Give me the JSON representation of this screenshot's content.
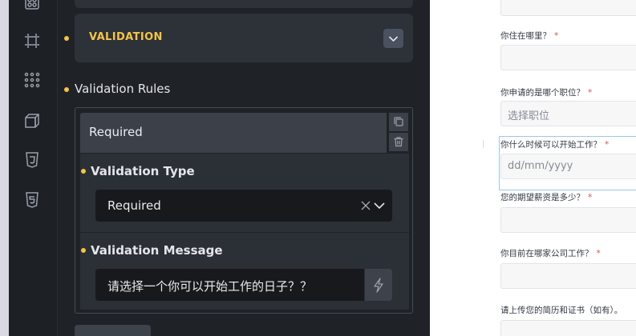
{
  "sidebar_icons": [
    "grid-icon",
    "frame-icon",
    "dots-grid-icon",
    "cube-icon",
    "css3-icon",
    "html5-icon"
  ],
  "panel": {
    "section_title": "VALIDATION",
    "rules_label": "Validation Rules",
    "rule": {
      "title": "Required",
      "validation_type_label": "Validation Type",
      "validation_type_value": "Required",
      "validation_message_label": "Validation Message",
      "validation_message_value": "请选择一个你可以开始工作的日子？？"
    }
  },
  "form": {
    "fields": [
      {
        "label": "你住在哪里？",
        "required": "*",
        "value": ""
      },
      {
        "label": "你申请的是哪个职位？",
        "required": "*",
        "placeholder": "选择职位"
      },
      {
        "label": "你什么时候可以开始工作？",
        "required": "*",
        "placeholder": "dd/mm/yyyy"
      },
      {
        "label": "您的期望薪资是多少？",
        "required": "*",
        "value": ""
      },
      {
        "label": "你目前在哪家公司工作？",
        "required": "*",
        "value": ""
      },
      {
        "label": "请上传您的简历和证书（如有）。",
        "value": ""
      }
    ]
  },
  "colors": {
    "accent": "#f4c44a",
    "panel_bg": "#1f2227",
    "card_bg": "#2d3138",
    "input_bg": "#17191d",
    "required": "#d9534f",
    "focus_border": "#9cc8ea"
  }
}
